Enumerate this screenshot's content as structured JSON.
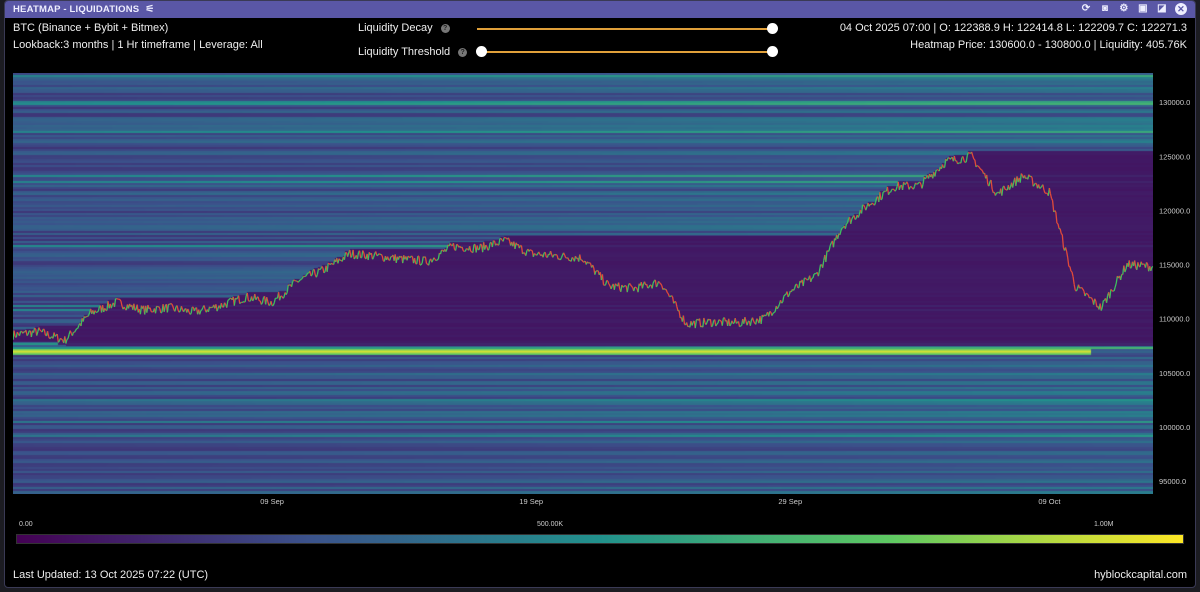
{
  "window": {
    "title": "HEATMAP - LIQUIDATIONS",
    "icons": [
      "settings-sliders-icon",
      "refresh-icon",
      "camera-icon",
      "gear-icon",
      "save-icon",
      "expand-icon",
      "close-icon"
    ]
  },
  "info": {
    "symbol": "BTC (Binance + Bybit + Bitmex)",
    "params": "Lookback:3 months | 1 Hr timeframe | Leverage: All",
    "ohlc": "04 Oct 2025 07:00 | O: 122388.9 H: 122414.8 L: 122209.7 C: 122271.3",
    "heatmap": "Heatmap Price: 130600.0 - 130800.0 | Liquidity: 405.76K"
  },
  "controls": [
    {
      "label": "Liquidity Decay",
      "value": 1.0
    },
    {
      "label": "Liquidity Threshold",
      "value": 0.0
    }
  ],
  "colors": {
    "title_bar": "#5a57a6",
    "price_up": "#3fbf5f",
    "price_down": "#e04a3a",
    "slider": "#e0a03a"
  },
  "colorbar": {
    "labels": [
      "0.00",
      "500.00K",
      "1.00M"
    ]
  },
  "footer": {
    "updated": "Last Updated: 13 Oct 2025 07:22 (UTC)",
    "brand": "hyblockcapital.com"
  },
  "chart_data": {
    "type": "heatmap",
    "y_ticks": [
      95000,
      100000,
      105000,
      110000,
      115000,
      120000,
      125000,
      130000
    ],
    "y_tick_labels": [
      "95000.0",
      "100000.0",
      "105000.0",
      "110000.0",
      "115000.0",
      "120000.0",
      "125000.0",
      "130000.0"
    ],
    "ylim": [
      93800,
      132700
    ],
    "x_ticks": [
      "09 Sep",
      "19 Sep",
      "29 Sep",
      "09 Oct"
    ],
    "price_dates_start": "30 Aug",
    "price_daily": [
      108500,
      108800,
      108000,
      110500,
      111500,
      110800,
      111000,
      110600,
      111200,
      112000,
      111500,
      113500,
      114500,
      116000,
      115800,
      115500,
      115300,
      116700,
      116500,
      117200,
      116000,
      115800,
      115600,
      113000,
      112800,
      113400,
      109500,
      109700,
      109600,
      110000,
      112500,
      114000,
      118500,
      120500,
      122200,
      122300,
      124500,
      125000,
      121500,
      123200,
      121700,
      113000,
      111000,
      115000,
      114800
    ],
    "bright_band_price": 107000
  }
}
